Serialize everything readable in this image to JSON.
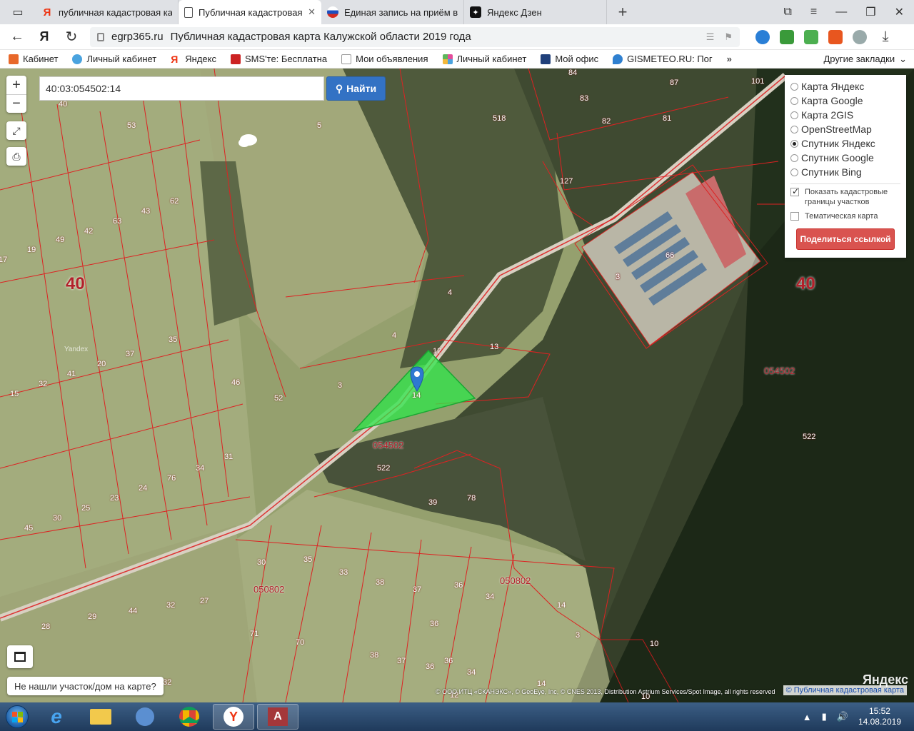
{
  "tabs": [
    {
      "title": "публичная кадастровая ка",
      "icon": "yandex-favicon"
    },
    {
      "title": "Публичная кадастровая",
      "icon": "document-favicon",
      "active": true
    },
    {
      "title": "Единая запись на приём в",
      "icon": "russia-flag-favicon"
    },
    {
      "title": "Яндекс Дзен",
      "icon": "zen-favicon"
    }
  ],
  "address": {
    "host": "egrp365.ru",
    "title": "Публичная кадастровая карта Калужской области 2019 года"
  },
  "bookmarks": [
    {
      "label": "Кабинет",
      "color": "#e8682a"
    },
    {
      "label": "Личный кабинет",
      "color": "#4aa3df"
    },
    {
      "label": "Яндекс",
      "color": "#e31"
    },
    {
      "label": "SMS'те: Бесплатна",
      "color": "#c22"
    },
    {
      "label": "Мои объявления",
      "color": "#777"
    },
    {
      "label": "Личный кабинет",
      "color": "#e44d9b"
    },
    {
      "label": "Мой офис",
      "color": "#1f3f7a"
    },
    {
      "label": "GISMETEO.RU: Пог",
      "color": "#2f80d0"
    }
  ],
  "bookmarks_other": "Другие закладки",
  "map": {
    "zoom_in": "+",
    "zoom_out": "−",
    "search_value": "40:03:054502:14",
    "search_button": "Найти",
    "layers": [
      "Карта Яндекс",
      "Карта Google",
      "Карта 2GIS",
      "OpenStreetMap",
      "Спутник Яндекс",
      "Спутник Google",
      "Спутник Bing"
    ],
    "selected_layer": "Спутник Яндекс",
    "show_borders_label": "Показать кадастровые границы участков",
    "thematic_label": "Тематическая карта",
    "share_button": "Поделиться ссылкой",
    "not_found": "Не нашли участок/дом на карте?",
    "yandex_brand": "Яндекс",
    "copyright": "© ООО ИТЦ «СКАНЭКС», © GeoEye, Inc, © CNES 2013, Distribution Astrium Services/Spot Image, all rights reserved",
    "copyright_link": "© Публичная кадастровая карта",
    "watermark_yandex": "Yandex",
    "district_labels": [
      "40",
      "40"
    ],
    "quarter_labels": [
      "054502",
      "054502",
      "050802",
      "050802"
    ],
    "selected_parcel": "14",
    "parcel_numbers": [
      "40",
      "53",
      "5",
      "518",
      "83",
      "87",
      "84",
      "81",
      "82",
      "101",
      "62",
      "43",
      "42",
      "63",
      "49",
      "19",
      "17",
      "35",
      "37",
      "20",
      "41",
      "32",
      "15",
      "46",
      "52",
      "4",
      "4",
      "13",
      "3",
      "12",
      "3",
      "66",
      "3",
      "522",
      "522",
      "76",
      "31",
      "34",
      "24",
      "23",
      "25",
      "30",
      "45",
      "78",
      "39",
      "35",
      "33",
      "38",
      "37",
      "36",
      "34",
      "14",
      "30",
      "29",
      "44",
      "32",
      "27",
      "28",
      "71",
      "70",
      "38",
      "37",
      "36",
      "36",
      "34",
      "14",
      "10",
      "10",
      "3",
      "32",
      "36",
      "12",
      "127"
    ]
  },
  "taskbar": {
    "time": "15:52",
    "date": "14.08.2019",
    "apps": [
      "ie",
      "explorer",
      "media",
      "chrome",
      "yandex-browser",
      "access"
    ]
  }
}
